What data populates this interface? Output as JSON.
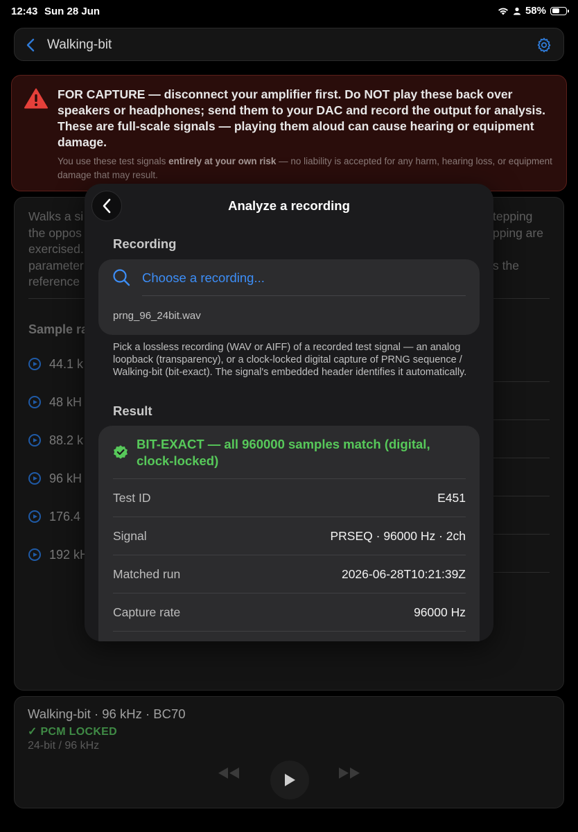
{
  "status_bar": {
    "time": "12:43",
    "date": "Sun 28 Jun",
    "battery": "58%",
    "battery_level": 0.58
  },
  "nav": {
    "title": "Walking-bit",
    "back_icon": "chevron-left-icon",
    "settings_icon": "gear-icon"
  },
  "warning": {
    "icon": "warning-triangle-icon",
    "main": "FOR CAPTURE — disconnect your amplifier first. Do NOT play these back over speakers or headphones; send them to your DAC and record the output for analysis. These are full-scale signals — playing them aloud can cause hearing or equipment damage.",
    "sub_prefix": "You use these test signals ",
    "sub_bold": "entirely at your own risk",
    "sub_suffix": " — no liability is accepted for any harm, hearing loss, or equipment damage that may result."
  },
  "background": {
    "left_lines": [
      "Walks a si",
      "the oppos",
      "exercised.",
      "parameter",
      "reference"
    ],
    "right_lines": [
      "tepping",
      "pping are",
      "",
      "s the"
    ],
    "sample_rate_header": "Sample ra",
    "rates": [
      "44.1 k",
      "48 kH",
      "88.2 k",
      "96 kH",
      "176.4",
      "192 kH"
    ]
  },
  "player": {
    "title": "Walking-bit · 96 kHz · BC70",
    "locked": "✓ PCM LOCKED",
    "format": "24-bit / 96 kHz",
    "controls": [
      "rewind-icon",
      "play-icon",
      "fast-forward-icon"
    ]
  },
  "modal": {
    "title": "Analyze a recording",
    "recording_label": "Recording",
    "choose": "Choose a recording...",
    "file": "prng_96_24bit.wav",
    "help": "Pick a lossless recording (WAV or AIFF) of a recorded test signal — an analog loopback (transparency), or a clock-locked digital capture of PRNG sequence / Walking-bit (bit-exact). The signal's embedded header identifies it automatically.",
    "result_label": "Result",
    "result_status": "BIT-EXACT — all 960000 samples match (digital, clock-locked)",
    "result_rows": [
      {
        "key": "Test ID",
        "value": "E451"
      },
      {
        "key": "Signal",
        "value": "PRSEQ · 96000 Hz · 2ch"
      },
      {
        "key": "Matched run",
        "value": "2026-06-28T10:21:39Z"
      },
      {
        "key": "Capture rate",
        "value": "96000 Hz"
      }
    ]
  },
  "colors": {
    "accent": "#3d8ef7",
    "success": "#57c95a",
    "warning_bg": "#2a0d0b",
    "warning_icon": "#e5403a"
  }
}
